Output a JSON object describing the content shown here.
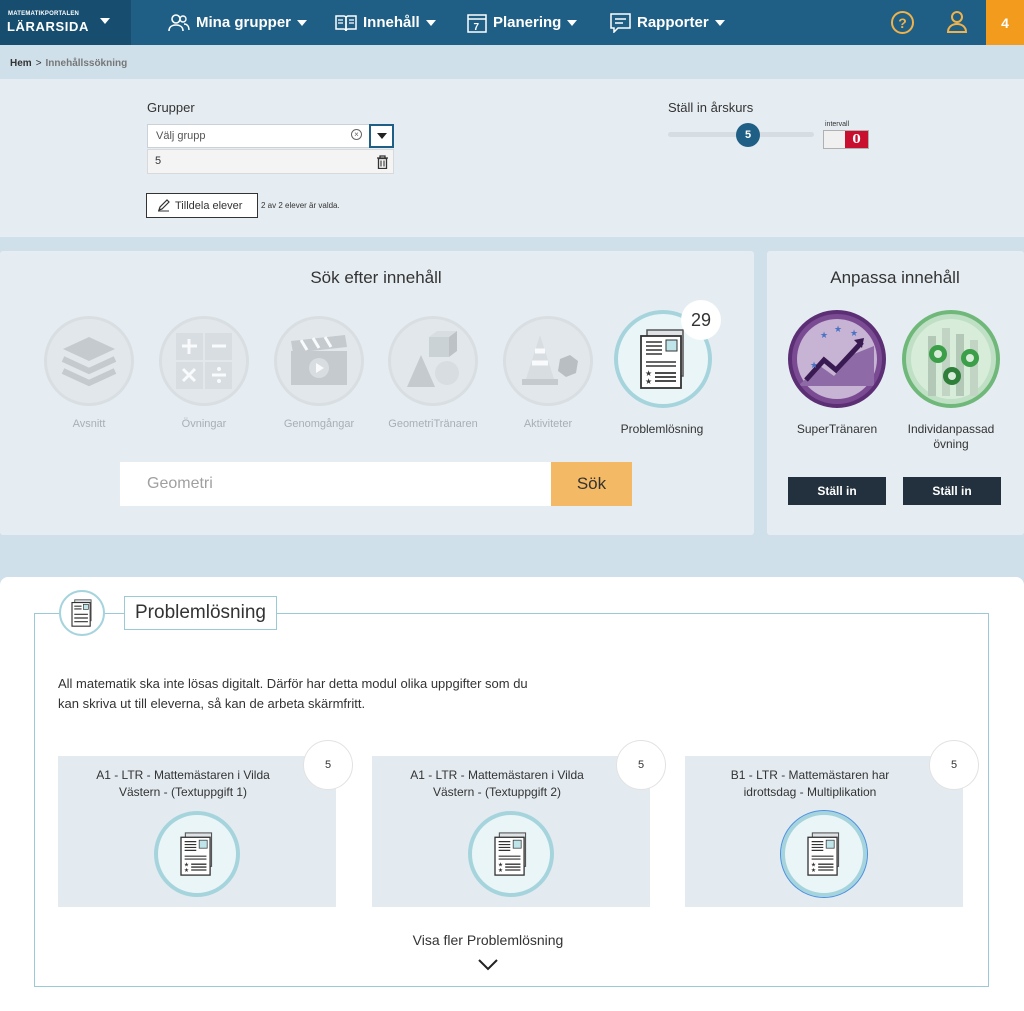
{
  "brand": {
    "small": "MATEMATIKPORTALEN",
    "big": "LÄRARSIDA"
  },
  "nav": [
    {
      "label": "Mina grupper",
      "icon": "users-icon"
    },
    {
      "label": "Innehåll",
      "icon": "book-icon"
    },
    {
      "label": "Planering",
      "icon": "calendar-icon"
    },
    {
      "label": "Rapporter",
      "icon": "report-icon"
    }
  ],
  "header": {
    "help": "?",
    "notifications": "4"
  },
  "breadcrumb": {
    "home": "Hem",
    "separator": ">",
    "current": "Innehållssökning"
  },
  "filter": {
    "groups_label": "Grupper",
    "group_placeholder": "Välj grupp",
    "selected_group": "5",
    "assign_label": "Tilldela elever",
    "assign_status": "2 av 2 elever är valda.",
    "grade_label": "Ställ in årskurs",
    "grade_value": "5",
    "interval_label": "intervall",
    "interval_toggle": "0"
  },
  "search": {
    "title": "Sök efter innehåll",
    "categories": [
      {
        "label": "Avsnitt",
        "icon": "layers-icon",
        "active": false
      },
      {
        "label": "Övningar",
        "icon": "math-operators-icon",
        "active": false
      },
      {
        "label": "Genomgångar",
        "icon": "clapperboard-icon",
        "active": false
      },
      {
        "label": "GeometriTränaren",
        "icon": "geometry-shapes-icon",
        "active": false
      },
      {
        "label": "Aktiviteter",
        "icon": "cone-icon",
        "active": false
      },
      {
        "label": "Problemlösning",
        "icon": "worksheet-icon",
        "active": true
      }
    ],
    "result_count": "29",
    "input_value": "Geometri",
    "button_label": "Sök"
  },
  "customize": {
    "title": "Anpassa innehåll",
    "items": [
      {
        "label": "SuperTränaren",
        "icon": "rising-chart-icon",
        "button": "Ställ in"
      },
      {
        "label": "Individanpassad övning",
        "icon": "gears-icon",
        "button": "Ställ in"
      }
    ]
  },
  "results": {
    "title": "Problemlösning",
    "description": "All matematik ska inte lösas digitalt. Därför har detta modul olika uppgifter som du kan skriva ut till eleverna, så kan de arbeta skärmfritt.",
    "cards": [
      {
        "title": "A1 - LTR - Mattemästaren i Vilda Västern - (Textuppgift 1)",
        "grade": "5"
      },
      {
        "title": "A1 - LTR - Mattemästaren i Vilda Västern - (Textuppgift 2)",
        "grade": "5"
      },
      {
        "title": "B1 - LTR - Mattemästaren har idrottsdag - Multiplikation",
        "grade": "5"
      }
    ],
    "more_label": "Visa fler Problemlösning"
  },
  "colors": {
    "nav": "#1f5f85",
    "accent": "#f29b1d",
    "search_button": "#f4b965",
    "dark_button": "#22313d"
  }
}
